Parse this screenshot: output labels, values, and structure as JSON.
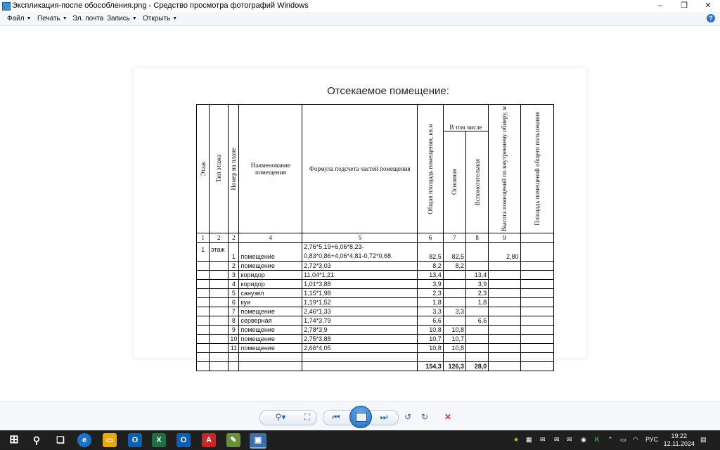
{
  "window": {
    "title": "Экспликация-после обособления.png - Средство просмотра фотографий Windows",
    "minimize": "–",
    "maximize": "❐",
    "close": "✕"
  },
  "menu": {
    "file": "Файл",
    "print": "Печать",
    "email": "Эл. почта",
    "burn": "Запись",
    "open": "Открыть",
    "help": "?"
  },
  "document": {
    "title": "Отсекаемое помещение:",
    "headers": {
      "floor": "Этаж",
      "floor_type": "Тип этажа",
      "plan_number": "Номер на плане",
      "room_name": "Наименование помещения",
      "formula": "Формула подсчета частей помещения",
      "total_area": "Общая площадь помещения, кв.м",
      "including": "В том числе",
      "main": "Основная",
      "auxiliary": "Вспомогательная",
      "height": "Высота помещений по внутреннему обмеру, м",
      "common_area": "Площадь помещений общего пользования"
    },
    "column_numbers": [
      "1",
      "2",
      "2",
      "4",
      "5",
      "6",
      "7",
      "8",
      "9",
      ""
    ],
    "rows": [
      {
        "floor": "1",
        "type": "этаж",
        "n": "1",
        "name": "помещение",
        "formula1": "2,76*5,19+6,06*8,23-",
        "formula2": "0,83*0,86+4,06*4,81-0,72*0,68",
        "total": "82,5",
        "main": "82,5",
        "aux": "",
        "height": "2,80",
        "common": ""
      },
      {
        "floor": "",
        "type": "",
        "n": "2",
        "name": "помещение",
        "formula": "2,72*3,03",
        "total": "8,2",
        "main": "8,2",
        "aux": "",
        "height": "",
        "common": ""
      },
      {
        "floor": "",
        "type": "",
        "n": "3",
        "name": "коридор",
        "formula": "11,04*1,21",
        "total": "13,4",
        "main": "",
        "aux": "13,4",
        "height": "",
        "common": ""
      },
      {
        "floor": "",
        "type": "",
        "n": "4",
        "name": "коридор",
        "formula": "1,01*3,88",
        "total": "3,9",
        "main": "",
        "aux": "3,9",
        "height": "",
        "common": ""
      },
      {
        "floor": "",
        "type": "",
        "n": "5",
        "name": "санузел",
        "formula": "1,15*1,98",
        "total": "2,3",
        "main": "",
        "aux": "2,3",
        "height": "",
        "common": ""
      },
      {
        "floor": "",
        "type": "",
        "n": "6",
        "name": "куи",
        "formula": "1,19*1,52",
        "total": "1,8",
        "main": "",
        "aux": "1,8",
        "height": "",
        "common": ""
      },
      {
        "floor": "",
        "type": "",
        "n": "7",
        "name": "помещение",
        "formula": "2,46*1,33",
        "total": "3,3",
        "main": "3,3",
        "aux": "",
        "height": "",
        "common": ""
      },
      {
        "floor": "",
        "type": "",
        "n": "8",
        "name": "серверная",
        "formula": "1,74*3,79",
        "total": "6,6",
        "main": "",
        "aux": "6,6",
        "height": "",
        "common": ""
      },
      {
        "floor": "",
        "type": "",
        "n": "9",
        "name": "помещение",
        "formula": "2,78*3,9",
        "total": "10,8",
        "main": "10,8",
        "aux": "",
        "height": "",
        "common": ""
      },
      {
        "floor": "",
        "type": "",
        "n": "10",
        "name": "помещение",
        "formula": "2,75*3,88",
        "total": "10,7",
        "main": "10,7",
        "aux": "",
        "height": "",
        "common": ""
      },
      {
        "floor": "",
        "type": "",
        "n": "11",
        "name": "помещение",
        "formula": "2,66*4,05",
        "total": "10,8",
        "main": "10,8",
        "aux": "",
        "height": "",
        "common": ""
      }
    ],
    "totals": {
      "total": "154,3",
      "main": "126,3",
      "aux": "28,0"
    }
  },
  "controls": {
    "zoom": "⚲▾",
    "fit": "⛶",
    "prev": "⏮",
    "next": "⏭",
    "rotate_ccw": "↺",
    "rotate_cw": "↻",
    "delete": "✕"
  },
  "taskbar": {
    "lang": "РУС",
    "time": "19:22",
    "date": "12.11.2024"
  },
  "colors": {
    "taskbar": "#1f1f1f",
    "delete": "#d32f2f",
    "control_icon": "#2a5fa8"
  }
}
